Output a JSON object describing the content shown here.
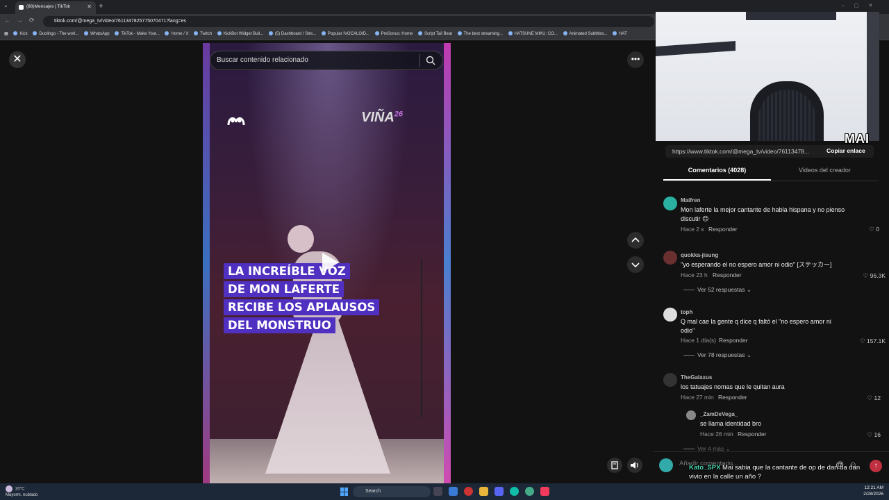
{
  "browser": {
    "tab_title": "(88)Mensajes | TikTok",
    "url": "tiktok.com/@mega_tv/video/7611347825775070471?lang=es",
    "bookmarks": [
      "Kick",
      "Duolingo - The worl...",
      "WhatsApp",
      "TikTok - Make Your...",
      "Home / X",
      "Twitch",
      "KickBot Widget Buil...",
      "(5) Dashboard / Stre...",
      "Popular !VOCALOID...",
      "PreSonus: Home",
      "Script Tail Beat",
      "The best streaming...",
      "HATSUNE MIKU: CO...",
      "Animated Subtitles...",
      "HAT"
    ]
  },
  "video": {
    "search_placeholder": "Buscar contenido relacionado",
    "logo_left": "mega",
    "logo_right": "VIÑA",
    "logo_right_sup": "26",
    "caption_lines": [
      "LA INCREÍBLE VOZ",
      "DE MON LAFERTE",
      "RECIBE LOS APLAUSOS",
      "DEL MONSTRUO"
    ]
  },
  "webcam": {
    "label": "MAI"
  },
  "share": {
    "link": "https://www.tiktok.com/@mega_tv/video/76113478...",
    "copy_label": "Copiar enlace"
  },
  "tabs": {
    "comments": "Comentarios (4028)",
    "creator": "Videos del creador"
  },
  "comments": [
    {
      "user": "Maifren",
      "text": "Mon laferte la mejor cantante de habla hispana y no pienso discutir 😊",
      "time": "Hace 2 s",
      "reply": "Responder",
      "likes": "0",
      "more": ""
    },
    {
      "user": "quokka-jisung",
      "text": "\"yo esperando el no espero amor ni odio\" [ステッカー]",
      "time": "Hace 23 h",
      "reply": "Responder",
      "likes": "96.3K",
      "more": "Ver 52 respuestas ⌄"
    },
    {
      "user": "toph",
      "text": "Q mal cae la gente q dice q faltó el \"no espero amor ni odio\"",
      "time": "Hace 1 día(s)",
      "reply": "Responder",
      "likes": "157.1K",
      "more": "Ver 78 respuestas ⌄"
    },
    {
      "user": "TheGalaxus",
      "text": "los tatuajes nomas que le quitan aura",
      "time": "Hace 27 min",
      "reply": "Responder",
      "likes": "12",
      "more": ""
    }
  ],
  "nested_reply": {
    "user": "_ZamDeVega_",
    "text": "se llama identidad bro",
    "time": "Hace 26 min",
    "reply": "Responder",
    "likes": "16",
    "more": "Ver 4 más ⌄"
  },
  "comment_bar": {
    "placeholder": "Añadir comentario..."
  },
  "chat_overlay": {
    "name": "Kato_SPX",
    "message": "Mai sabia que la cantante de op de dan da dan vivio en la calle un año ?"
  },
  "taskbar": {
    "temp": "20°C",
    "weather": "Mayorm. nublado",
    "search": "Search",
    "time": "12:21 AM",
    "date": "2/28/2026"
  }
}
